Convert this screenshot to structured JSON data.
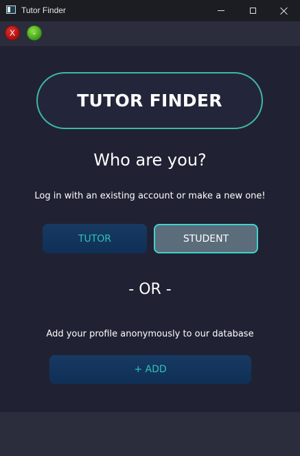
{
  "window": {
    "title": "Tutor Finder"
  },
  "toolbar": {
    "close_label": "X",
    "minimize_label": "-"
  },
  "main": {
    "logo_text": "TUTOR FINDER",
    "question": "Who are you?",
    "subtitle": "Log in with an existing account or make a new one!",
    "tutor_label": "TUTOR",
    "student_label": "STUDENT",
    "or_text": "- OR -",
    "add_prompt": "Add your profile anonymously to our database",
    "add_label": "+ ADD"
  },
  "colors": {
    "background": "#202233",
    "panel": "#2b2d3c",
    "accent_teal": "#3fb8a5",
    "button_blue": "#0f2f55",
    "selected_button": "#5b6c7b"
  },
  "icons": {
    "app": "app-icon",
    "minimize": "minimize-icon",
    "maximize": "maximize-icon",
    "close": "close-icon"
  }
}
